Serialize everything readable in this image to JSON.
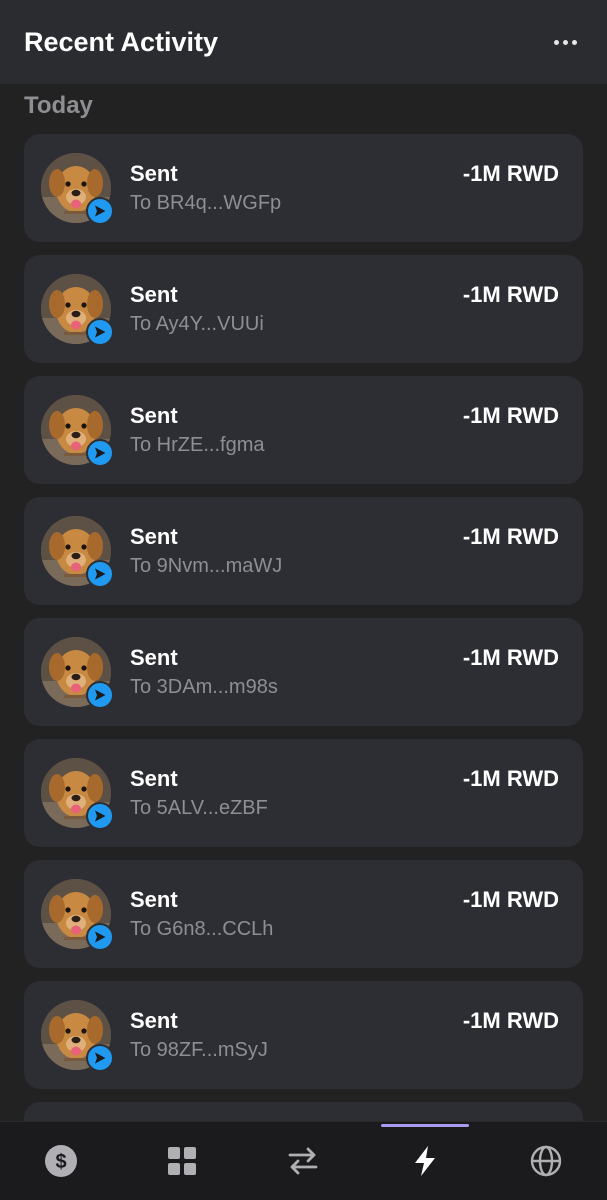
{
  "header": {
    "title": "Recent Activity",
    "menu_icon": "more-horizontal-icon"
  },
  "section": {
    "label": "Today"
  },
  "activities": [
    {
      "title": "Sent",
      "recipient": "To BR4q...WGFp",
      "amount": "-1M RWD"
    },
    {
      "title": "Sent",
      "recipient": "To Ay4Y...VUUi",
      "amount": "-1M RWD"
    },
    {
      "title": "Sent",
      "recipient": "To HrZE...fgma",
      "amount": "-1M RWD"
    },
    {
      "title": "Sent",
      "recipient": "To 9Nvm...maWJ",
      "amount": "-1M RWD"
    },
    {
      "title": "Sent",
      "recipient": "To 3DAm...m98s",
      "amount": "-1M RWD"
    },
    {
      "title": "Sent",
      "recipient": "To 5ALV...eZBF",
      "amount": "-1M RWD"
    },
    {
      "title": "Sent",
      "recipient": "To G6n8...CCLh",
      "amount": "-1M RWD"
    },
    {
      "title": "Sent",
      "recipient": "To 98ZF...mSyJ",
      "amount": "-1M RWD"
    }
  ],
  "nav": {
    "active_index": 3,
    "items": [
      {
        "icon": "dollar-icon"
      },
      {
        "icon": "grid-icon"
      },
      {
        "icon": "swap-icon"
      },
      {
        "icon": "lightning-icon"
      },
      {
        "icon": "globe-icon"
      }
    ]
  },
  "colors": {
    "background": "#222222",
    "header_bg": "#2b2c30",
    "card_bg": "#2d2e33",
    "badge_blue": "#1f9af0",
    "muted_text": "#8e8e93",
    "active_indicator": "#a99bf2"
  }
}
